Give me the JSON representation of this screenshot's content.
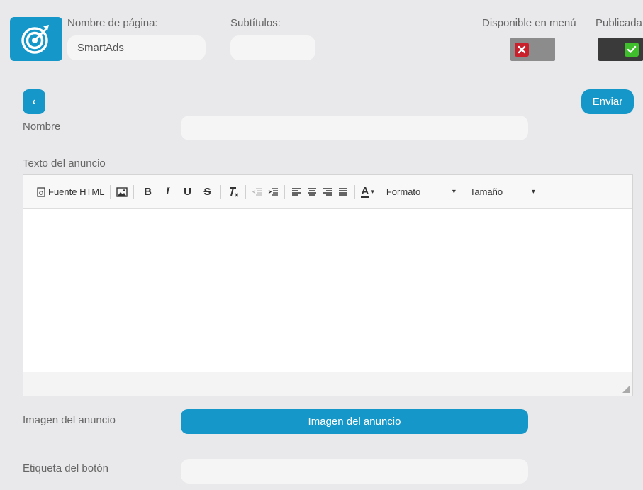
{
  "header": {
    "page_name_label": "Nombre de página:",
    "page_name_value": "SmartAds",
    "subtitles_label": "Subtítulos:",
    "subtitles_value": "",
    "menu_available_label": "Disponible en menú",
    "menu_available": false,
    "published_label": "Publicada",
    "published": true
  },
  "actions": {
    "back_label": "‹",
    "send_label": "Enviar"
  },
  "form": {
    "name_label": "Nombre",
    "name_value": "",
    "ad_text_label": "Texto del anuncio",
    "ad_image_label": "Imagen del anuncio",
    "ad_image_button": "Imagen del anuncio",
    "button_tag_label": "Etiqueta del botón",
    "button_tag_value": ""
  },
  "editor": {
    "source_label": "Fuente HTML",
    "bold": "B",
    "italic": "I",
    "underline": "U",
    "strike": "S",
    "text_color": "A",
    "format_label": "Formato",
    "size_label": "Tamaño",
    "content": ""
  },
  "colors": {
    "accent": "#1598c9",
    "off_badge": "#c9202b",
    "on_badge": "#3fbf2b"
  }
}
